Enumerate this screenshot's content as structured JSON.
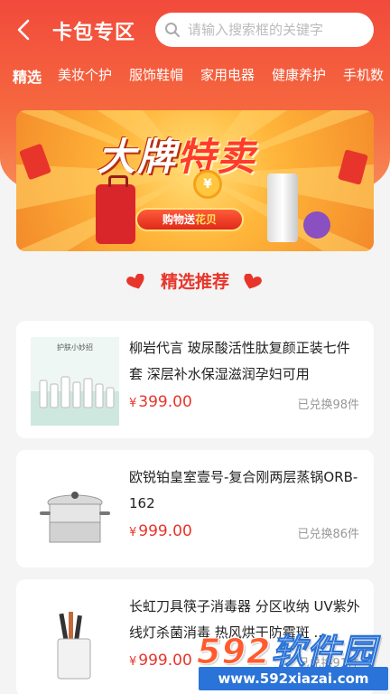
{
  "header": {
    "title": "卡包专区",
    "search_placeholder": "请输入搜索框的关键字"
  },
  "tabs": [
    {
      "label": "精选",
      "active": true
    },
    {
      "label": "美妆个护"
    },
    {
      "label": "服饰鞋帽"
    },
    {
      "label": "家用电器"
    },
    {
      "label": "健康养护"
    },
    {
      "label": "手机数"
    }
  ],
  "banner": {
    "title_part1": "大牌",
    "title_part2": "特卖",
    "coin_text": "¥",
    "button_prefix": "购物送",
    "button_highlight": "花贝"
  },
  "section": {
    "title": "精选推荐"
  },
  "products": [
    {
      "name": "柳岩代言 玻尿酸活性肽复颜正装七件套 深层补水保湿滋润孕妇可用",
      "price_symbol": "¥",
      "price": "399.00",
      "exchanged": "已兑换98件",
      "thumb_text": "护肤小妙招"
    },
    {
      "name": "欧锐铂皇室壹号-复合刚两层蒸锅ORB-162",
      "price_symbol": "¥",
      "price": "999.00",
      "exchanged": "已兑换86件"
    },
    {
      "name": "长虹刀具筷子消毒器 分区收纳 UV紫外线灯杀菌消毒 热风烘干防霉斑 ...",
      "price_symbol": "¥",
      "price": "999.00",
      "exchanged": "已兑换91件"
    }
  ],
  "watermark": {
    "logo_num": "592",
    "logo_text": "软件园",
    "url": "www.592xiazai.com"
  },
  "colors": {
    "accent": "#e8352b",
    "header": "#f24a3c"
  }
}
